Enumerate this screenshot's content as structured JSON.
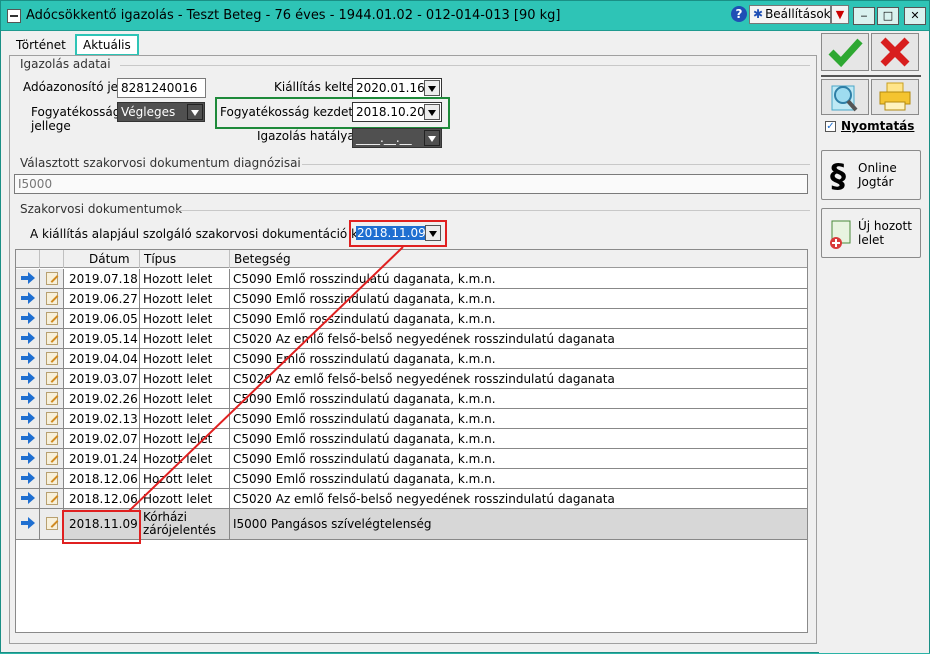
{
  "window": {
    "title": "Adócsökkentő igazolás - Teszt Beteg - 76 éves - 1944.01.02 - 012-014-013 [90 kg]",
    "help_label": "?",
    "settings_label": "Beállítások",
    "min_label": "‒",
    "max_label": "□",
    "close_label": "✕"
  },
  "tabs": [
    {
      "label": "Történet",
      "active": false
    },
    {
      "label": "Aktuális",
      "active": true
    }
  ],
  "igazolas": {
    "section_title": "Igazolás adatai",
    "tax_id_label": "Adóazonosító jel",
    "tax_id_value": "8281240016",
    "disability_type_label": "Fogyatékosság jellege",
    "disability_type_value": "Végleges",
    "issue_date_label": "Kiállítás kelte",
    "issue_date_value": "2020.01.16",
    "disability_start_label": "Fogyatékosság kezdete",
    "disability_start_value": "2018.10.20",
    "validity_label": "Igazolás hatálya",
    "validity_value": "____.__.__"
  },
  "diagnosis": {
    "section_title": "Választott szakorvosi dokumentum diagnózisai",
    "value": "I5000"
  },
  "documents": {
    "section_title": "Szakorvosi dokumentumok",
    "basis_label": "A kiállítás alapjául szolgáló szakorvosi dokumentáció kelte",
    "basis_value": "2018.11.09",
    "columns": [
      "",
      "",
      "Dátum",
      "Típus",
      "Betegség"
    ],
    "rows": [
      {
        "date": "2019.07.18",
        "type": "Hozott lelet",
        "disease": "C5090 Emlő rosszindulatú daganata, k.m.n."
      },
      {
        "date": "2019.06.27",
        "type": "Hozott lelet",
        "disease": "C5090 Emlő rosszindulatú daganata, k.m.n."
      },
      {
        "date": "2019.06.05",
        "type": "Hozott lelet",
        "disease": "C5090 Emlő rosszindulatú daganata, k.m.n."
      },
      {
        "date": "2019.05.14",
        "type": "Hozott lelet",
        "disease": "C5020 Az emlő felső-belső negyedének rosszindulatú daganata"
      },
      {
        "date": "2019.04.04",
        "type": "Hozott lelet",
        "disease": "C5090 Emlő rosszindulatú daganata, k.m.n."
      },
      {
        "date": "2019.03.07",
        "type": "Hozott lelet",
        "disease": "C5020 Az emlő felső-belső negyedének rosszindulatú daganata"
      },
      {
        "date": "2019.02.26",
        "type": "Hozott lelet",
        "disease": "C5090 Emlő rosszindulatú daganata, k.m.n."
      },
      {
        "date": "2019.02.13",
        "type": "Hozott lelet",
        "disease": "C5090 Emlő rosszindulatú daganata, k.m.n."
      },
      {
        "date": "2019.02.07",
        "type": "Hozott lelet",
        "disease": "C5090 Emlő rosszindulatú daganata, k.m.n."
      },
      {
        "date": "2019.01.24",
        "type": "Hozott lelet",
        "disease": "C5090 Emlő rosszindulatú daganata, k.m.n."
      },
      {
        "date": "2018.12.06",
        "type": "Hozott lelet",
        "disease": "C5090 Emlő rosszindulatú daganata, k.m.n."
      },
      {
        "date": "2018.12.06",
        "type": "Hozott lelet",
        "disease": "C5020 Az emlő felső-belső negyedének rosszindulatú daganata"
      },
      {
        "date": "2018.11.09",
        "type": "Kórházi zárójelentés",
        "disease": "I5000 Pangásos szívelégtelenség",
        "selected": true
      }
    ]
  },
  "sidebar": {
    "print_label": "Nyomtatás",
    "print_checked": true,
    "jogtar_label_1": "Online",
    "jogtar_label_2": "Jogtár",
    "jogtar_glyph": "§",
    "new_result_label_1": "Új hozott",
    "new_result_label_2": "lelet"
  },
  "colors": {
    "titlebar": "#2ec4b6",
    "annotation_red": "#e02020",
    "annotation_green": "#1e8a3a",
    "ok_green": "#2ea832",
    "cancel_red": "#d81e1e",
    "selection_blue": "#1f6fd1"
  }
}
